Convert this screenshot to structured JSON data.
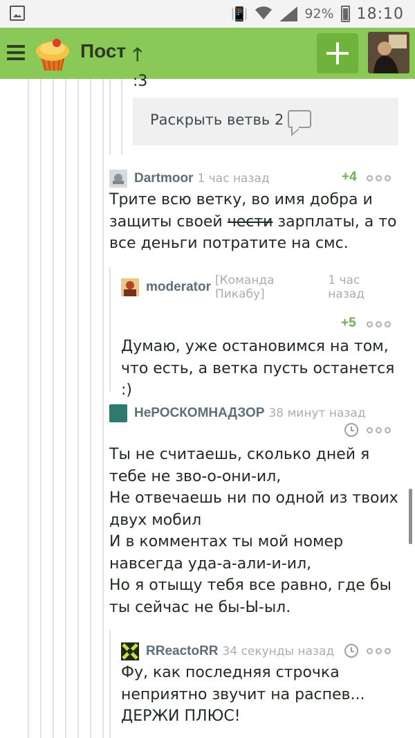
{
  "status_bar": {
    "battery": "92%",
    "time": "18:10"
  },
  "header": {
    "title": "Пост"
  },
  "thread": {
    "prev_tail": ":3",
    "expand": {
      "label": "Раскрыть ветвь",
      "count": "2"
    },
    "comments": [
      {
        "author": "Dartmoor",
        "time": "1 час назад",
        "rating": "+4",
        "text_before": "Трите всю ветку, во имя добра и защиты своей ",
        "text_struck": "чести",
        "text_after": " зарплаты, а то все деньги потратите на смс."
      },
      {
        "author": "moderator",
        "badge": "[Команда Пикабу]",
        "time": "1 час назад",
        "rating": "+5",
        "text": "Думаю, уже остановимся на том, что есть, а ветка пусть останется :)"
      },
      {
        "author": "НеРОСКОМНАДЗОР",
        "time": "38 минут назад",
        "lines": [
          "Ты не считаешь, сколько дней я тебе не зво-о-они-ил,",
          "Не отвечаешь ни по одной из твоих двух мобил",
          "И в комментах ты мой номер навсегда уда-а-али-и-ил,",
          "Но я отыщу тебя все равно, где бы ты сейчас не бы-Ы-ыл."
        ]
      },
      {
        "author": "RReactoRR",
        "time": "34 секунды назад",
        "text": "Фу, как последняя строчка неприятно звучит на распев... ДЕРЖИ ПЛЮС!"
      }
    ]
  },
  "colors": {
    "header_bg": "#8ac858",
    "rating": "#6ab04c",
    "author": "#5b6f7a"
  }
}
